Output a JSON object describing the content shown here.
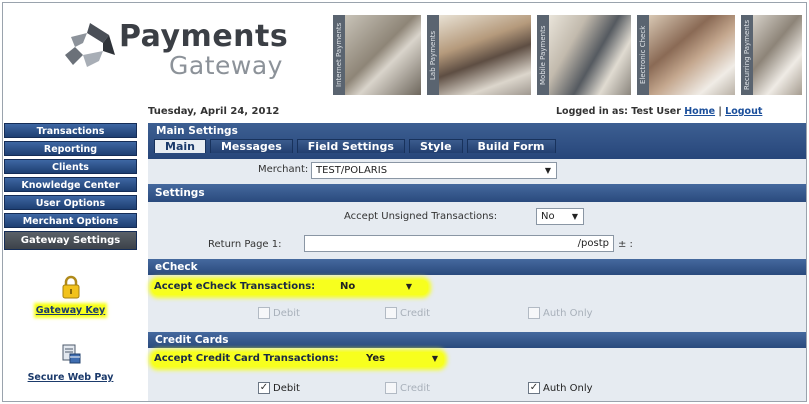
{
  "brand": {
    "name_line1": "Payments",
    "name_line2": "Gateway"
  },
  "banner": {
    "strip_labels": [
      "Internet Payments",
      "Lab Payments",
      "Mobile Payments",
      "Electronic Check",
      "Recurring Payments"
    ]
  },
  "header": {
    "date": "Tuesday, April 24, 2012",
    "logged_in_prefix": "Logged in as:",
    "user": "Test User",
    "home_link": "Home",
    "separator": "|",
    "logout_link": "Logout"
  },
  "sidebar": {
    "items": [
      {
        "label": "Transactions"
      },
      {
        "label": "Reporting"
      },
      {
        "label": "Clients"
      },
      {
        "label": "Knowledge Center"
      },
      {
        "label": "User Options"
      },
      {
        "label": "Merchant Options"
      },
      {
        "label": "Gateway Settings"
      }
    ],
    "tools": [
      {
        "label": "Gateway Key",
        "icon": "lock-icon"
      },
      {
        "label": "Secure Web Pay",
        "icon": "secure-web-pay-icon"
      }
    ]
  },
  "main": {
    "title": "Main Settings",
    "tabs": [
      {
        "label": "Main",
        "active": true
      },
      {
        "label": "Messages"
      },
      {
        "label": "Field Settings"
      },
      {
        "label": "Style"
      },
      {
        "label": "Build Form"
      }
    ],
    "merchant": {
      "label": "Merchant:",
      "value": "TEST/POLARIS"
    },
    "settings": {
      "title": "Settings",
      "unsigned_label": "Accept Unsigned Transactions:",
      "unsigned_value": "No",
      "return_label": "Return Page 1:",
      "return_value": "/postp",
      "return_tail": "± :"
    },
    "echeck": {
      "title": "eCheck",
      "accept_label": "Accept eCheck Transactions:",
      "accept_value": "No",
      "options": [
        {
          "label": "Debit",
          "checked": false
        },
        {
          "label": "Credit",
          "checked": false
        },
        {
          "label": "Auth Only",
          "checked": false
        }
      ]
    },
    "credit": {
      "title": "Credit Cards",
      "accept_label": "Accept Credit Card Transactions:",
      "accept_value": "Yes",
      "options": [
        {
          "label": "Debit",
          "checked": true
        },
        {
          "label": "Credit",
          "checked": false
        },
        {
          "label": "Auth Only",
          "checked": true
        }
      ]
    }
  },
  "colors": {
    "nav": "#1e3f72",
    "highlight": "#f7ff1e",
    "panel": "#e6ebf1"
  }
}
